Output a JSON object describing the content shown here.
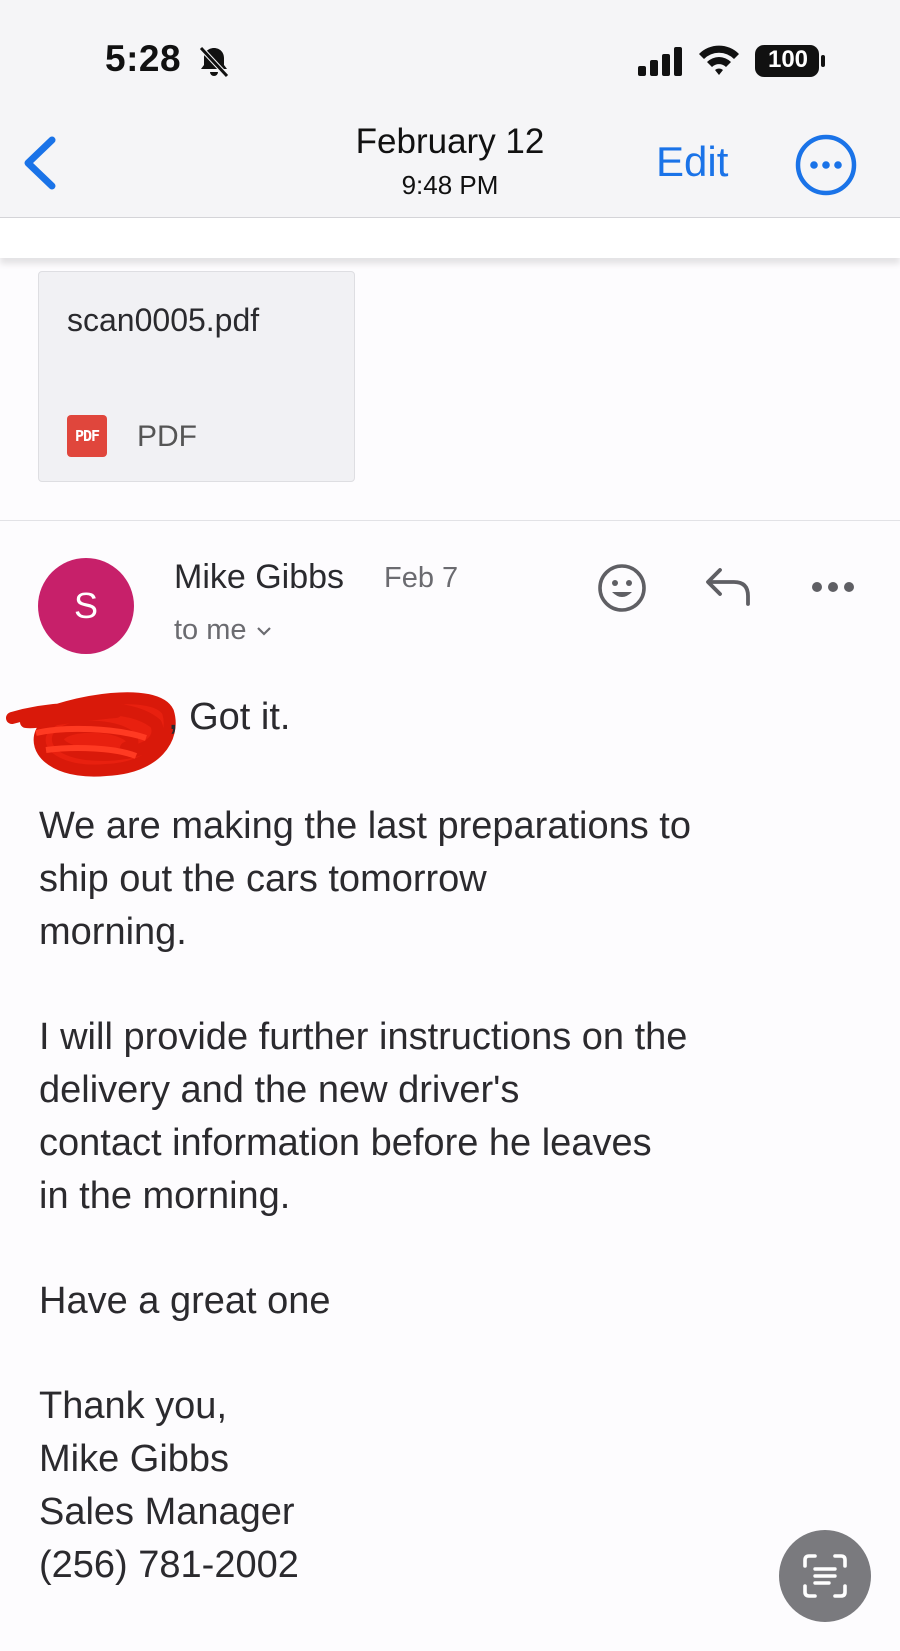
{
  "status_bar": {
    "time": "5:28",
    "battery": "100",
    "icons": [
      "bell-slash-icon",
      "signal-icon",
      "wifi-icon",
      "battery-icon"
    ]
  },
  "nav": {
    "title": "February 12",
    "subtitle": "9:48 PM",
    "edit_label": "Edit",
    "icons": [
      "back-chevron-icon",
      "more-circle-icon"
    ],
    "accent_color": "#1a73e8"
  },
  "attachment": {
    "filename": "scan0005.pdf",
    "badge": "PDF",
    "type_label": "PDF",
    "badge_color": "#e0463c"
  },
  "message": {
    "avatar_letter": "S",
    "avatar_color": "#c7206a",
    "sender": "Mike Gibbs",
    "date": "Feb 7",
    "recipient": "to me",
    "actions": [
      "emoji-icon",
      "reply-icon",
      "more-dots-icon"
    ],
    "greeting": ", Got it.",
    "paragraph_1": "We are making the last preparations to\nship out the cars tomorrow\nmorning.",
    "paragraph_2": "I will provide further instructions on the\ndelivery and the new driver's\ncontact information before he leaves\nin the morning.",
    "paragraph_3": "Have a great one",
    "signature": "Thank you,\nMike Gibbs\nSales Manager\n(256) 781-2002"
  },
  "floating_button": {
    "icon": "text-scan-icon"
  }
}
